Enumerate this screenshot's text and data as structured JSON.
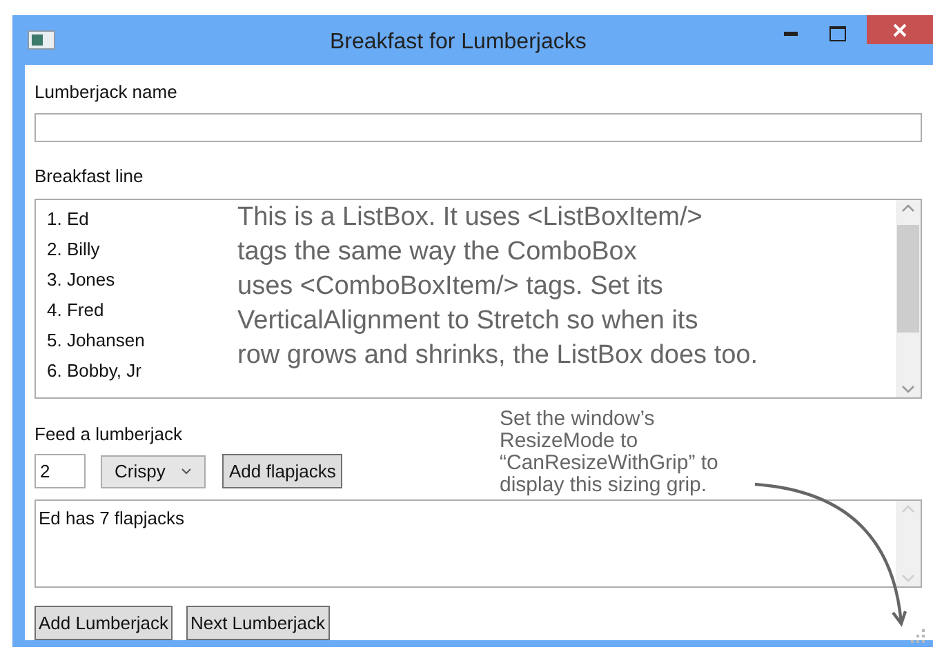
{
  "window": {
    "title": "Breakfast for Lumberjacks"
  },
  "name_label": "Lumberjack name",
  "breakfast_label": "Breakfast line",
  "breakfast_list": [
    "1. Ed",
    "2. Billy",
    "3. Jones",
    "4. Fred",
    "5. Johansen",
    "6. Bobby, Jr"
  ],
  "feed_label": "Feed a lumberjack",
  "quantity_field": {
    "value": "2"
  },
  "style_dropdown": {
    "value": "Crispy"
  },
  "add_flapjacks_button": "Add flapjacks",
  "output_box": {
    "value": "Ed has 7 flapjacks"
  },
  "buttons": [
    "Add Lumberjack",
    "Next Lumberjack"
  ],
  "annotations": [
    {
      "lines": [
        "This is a ListBox. It uses <ListBoxItem/>",
        "tags the same way the ComboBox",
        "uses <ComboBoxItem/> tags. Set its",
        "VerticalAlignment to Stretch so when its",
        "row grows and shrinks, the ListBox does too."
      ]
    },
    {
      "lines": [
        "Set the window’s",
        "ResizeMode to",
        "“CanResizeWithGrip” to",
        "display this sizing grip."
      ]
    }
  ]
}
